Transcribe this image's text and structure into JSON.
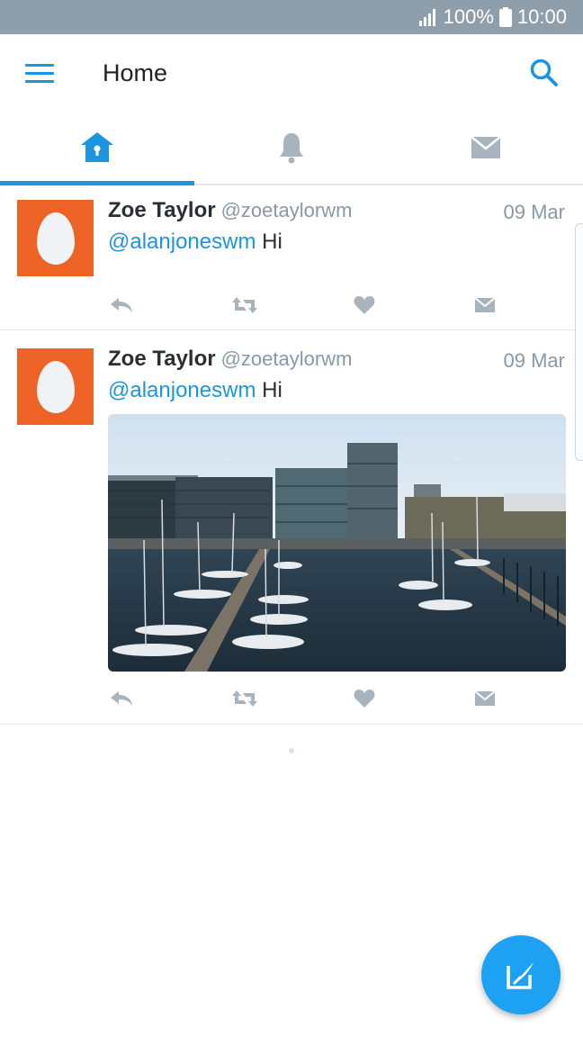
{
  "status_bar": {
    "battery": "100%",
    "time": "10:00"
  },
  "app_bar": {
    "title": "Home"
  },
  "tabs": [
    {
      "name": "home",
      "icon": "home-icon",
      "active": true
    },
    {
      "name": "notifications",
      "icon": "bell-icon",
      "active": false
    },
    {
      "name": "messages",
      "icon": "envelope-icon",
      "active": false
    }
  ],
  "tweets": [
    {
      "name": "Zoe Taylor",
      "handle": "@zoetaylorwm",
      "date": "09 Mar",
      "mention": "@alanjoneswm",
      "text": "Hi",
      "has_image": false
    },
    {
      "name": "Zoe Taylor",
      "handle": "@zoetaylorwm",
      "date": "09 Mar",
      "mention": "@alanjoneswm",
      "text": "Hi",
      "has_image": true,
      "image": "harbor-photo"
    }
  ],
  "colors": {
    "accent": "#1b95e0",
    "avatar": "#ed6325",
    "status_bar": "#8f9eab",
    "fab": "#1da1f2"
  }
}
